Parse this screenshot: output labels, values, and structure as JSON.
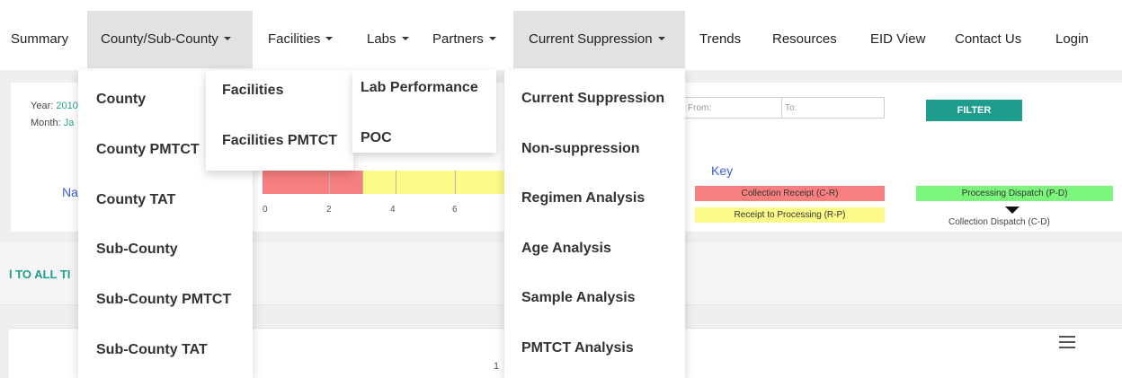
{
  "nav": {
    "items": [
      {
        "label": "Summary"
      },
      {
        "label": "County/Sub-County"
      },
      {
        "label": "Facilities"
      },
      {
        "label": "Labs"
      },
      {
        "label": "Partners"
      },
      {
        "label": "Current Suppression"
      },
      {
        "label": "Trends"
      },
      {
        "label": "Resources"
      },
      {
        "label": "EID View"
      },
      {
        "label": "Contact Us"
      },
      {
        "label": "Login"
      }
    ]
  },
  "menus": {
    "county": [
      "County",
      "County PMTCT",
      "County TAT",
      "Sub-County",
      "Sub-County PMTCT",
      "Sub-County TAT"
    ],
    "facilities": [
      "Facilities",
      "Facilities PMTCT"
    ],
    "labs": [
      "Lab Performance",
      "POC"
    ],
    "suppression": [
      "Current Suppression",
      "Non-suppression",
      "Regimen Analysis",
      "Age Analysis",
      "Sample Analysis",
      "PMTCT Analysis"
    ]
  },
  "filter": {
    "year_label": "Year:",
    "year_value": "2010",
    "month_label": "Month:",
    "month_value": "Ja",
    "from_label": "From:",
    "to_label": "To:",
    "filter_button": "FILTER",
    "mark_a": ":",
    "mark_b": "."
  },
  "tat": {
    "name_fragment": "Na",
    "scale_labels": [
      "0",
      "2",
      "4",
      "6"
    ],
    "key_title": "Key",
    "collection_receipt": "Collection Receipt (C-R)",
    "receipt_processing": "Receipt to Processing (R-P)",
    "processing_dispatch": "Processing Dispatch (P-D)",
    "collection_dispatch": "Collection Dispatch (C-D)",
    "colors": {
      "cr": "#f77f7f",
      "rp": "#fbfb8a",
      "pd": "#7cf57c"
    }
  },
  "section": {
    "title_fragment": "l TO ALL TI",
    "chart_fragment": "1"
  }
}
